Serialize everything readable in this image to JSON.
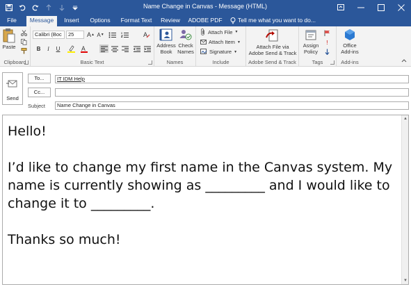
{
  "window": {
    "title": "Name Change in Canvas - Message (HTML)"
  },
  "tabs": [
    {
      "label": "File"
    },
    {
      "label": "Message"
    },
    {
      "label": "Insert"
    },
    {
      "label": "Options"
    },
    {
      "label": "Format Text"
    },
    {
      "label": "Review"
    },
    {
      "label": "ADOBE PDF"
    }
  ],
  "tell_me": "Tell me what you want to do...",
  "ribbon": {
    "clipboard": {
      "paste": "Paste",
      "label": "Clipboard"
    },
    "basic_text": {
      "font_name": "Calibri (Boc",
      "font_size": "25",
      "label": "Basic Text"
    },
    "names": {
      "address_book_1": "Address",
      "address_book_2": "Book",
      "check_names_1": "Check",
      "check_names_2": "Names",
      "label": "Names"
    },
    "include": {
      "attach_file": "Attach File",
      "attach_item": "Attach Item",
      "signature": "Signature",
      "label": "Include"
    },
    "adobe": {
      "line1": "Attach File via",
      "line2": "Adobe Send & Track",
      "label": "Adobe Send & Track"
    },
    "tags": {
      "line1": "Assign",
      "line2": "Policy",
      "label": "Tags"
    },
    "addins": {
      "line1": "Office",
      "line2": "Add-ins",
      "label": "Add-ins"
    }
  },
  "compose": {
    "send_label": "Send",
    "to_button": "To...",
    "cc_button": "Cc...",
    "subject_label": "Subject",
    "to_value": "IT IDM Help",
    "cc_value": "",
    "subject_value": "Name Change in Canvas"
  },
  "body": {
    "greeting": "Hello!",
    "paragraph": "I’d like to change my first name in the Canvas system. My name is currently showing as _________ and I would like to change it to _________.",
    "closing": "Thanks so much!"
  },
  "colors": {
    "titlebar": "#2b579a",
    "ribbon": "#f3f3f3"
  }
}
